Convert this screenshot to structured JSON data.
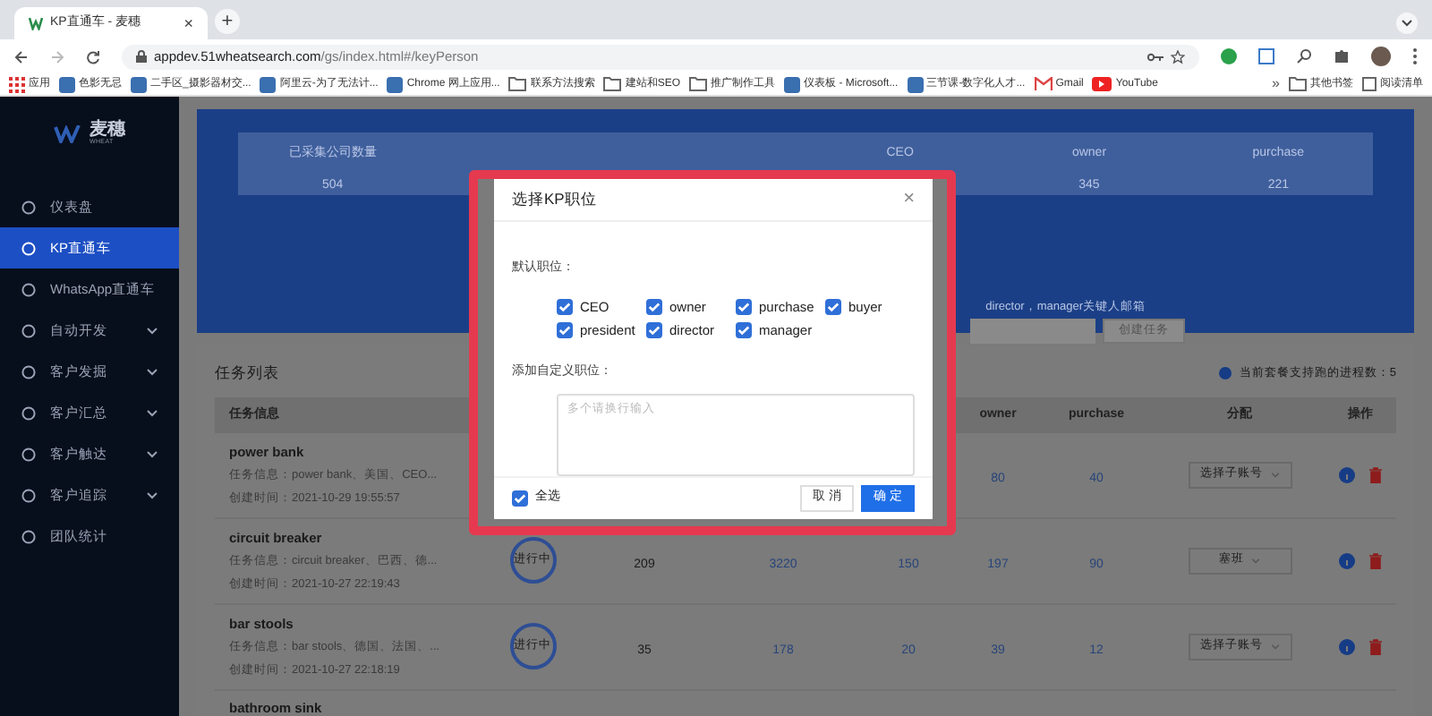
{
  "browser": {
    "tab_title": "KP直通车 - 麦穗",
    "tab_close": "×",
    "new_tab": "+",
    "url_host": "appdev.51wheatsearch.com",
    "url_path": "/gs/index.html#/keyPerson",
    "bookmarks": [
      {
        "label": "应用",
        "kind": "apps"
      },
      {
        "label": "色影无忌",
        "kind": "site"
      },
      {
        "label": "二手区_摄影器材交...",
        "kind": "site"
      },
      {
        "label": "阿里云-为了无法计...",
        "kind": "site"
      },
      {
        "label": "Chrome 网上应用...",
        "kind": "site"
      },
      {
        "label": "联系方法搜索",
        "kind": "folder"
      },
      {
        "label": "建站和SEO",
        "kind": "folder"
      },
      {
        "label": "推广制作工具",
        "kind": "folder"
      },
      {
        "label": "仪表板 - Microsoft...",
        "kind": "site"
      },
      {
        "label": "三节课-数字化人才...",
        "kind": "site"
      },
      {
        "label": "Gmail",
        "kind": "gmail"
      },
      {
        "label": "YouTube",
        "kind": "youtube"
      }
    ],
    "more": "»",
    "other_bookmarks": "其他书签",
    "reading_list": "阅读清单"
  },
  "sidebar": {
    "logo_text": "麦穗",
    "logo_sub": "WHEAT",
    "items": [
      {
        "label": "仪表盘",
        "selected": false,
        "expandable": false
      },
      {
        "label": "KP直通车",
        "selected": true,
        "expandable": false
      },
      {
        "label": "WhatsApp直通车",
        "selected": false,
        "expandable": false
      },
      {
        "label": "自动开发",
        "selected": false,
        "expandable": true
      },
      {
        "label": "客户发掘",
        "selected": false,
        "expandable": true
      },
      {
        "label": "客户汇总",
        "selected": false,
        "expandable": true
      },
      {
        "label": "客户触达",
        "selected": false,
        "expandable": true
      },
      {
        "label": "客户追踪",
        "selected": false,
        "expandable": true
      },
      {
        "label": "团队统计",
        "selected": false,
        "expandable": false
      }
    ]
  },
  "banner": {
    "stats": [
      {
        "label": "已采集公司数量",
        "value": "504"
      },
      {
        "label": "CEO"
      },
      {
        "label": "owner",
        "value": "345"
      },
      {
        "label": "purchase",
        "value": "221"
      }
    ],
    "hint": "director，manager关键人邮箱",
    "create_button": "创建任务"
  },
  "tasks": {
    "title": "任务列表",
    "quota": "当前套餐支持跑的进程数：5",
    "columns": {
      "info": "任务信息",
      "owner": "owner",
      "purchase": "purchase",
      "assign": "分配",
      "actions": "操作"
    },
    "rows": [
      {
        "name": "power bank",
        "info": "任务信息：power bank、美国、CEO...",
        "created": "创建时间：2021-10-29 19:55:57",
        "counts": [
          "80",
          "40"
        ],
        "assign": "选择子账号"
      },
      {
        "name": "circuit breaker",
        "info": "任务信息：circuit breaker、巴西、德...",
        "created": "创建时间：2021-10-27 22:19:43",
        "status": "进行中",
        "counts": [
          "209",
          "3220",
          "150",
          "197",
          "90"
        ],
        "assign": "塞班"
      },
      {
        "name": "bar stools",
        "info": "任务信息：bar stools、德国、法国、...",
        "created": "创建时间：2021-10-27 22:18:19",
        "status": "进行中",
        "counts": [
          "35",
          "178",
          "20",
          "39",
          "12"
        ],
        "assign": "选择子账号"
      },
      {
        "name": "bathroom sink"
      }
    ]
  },
  "modal": {
    "title": "选择KP职位",
    "close": "×",
    "default_label": "默认职位：",
    "options": [
      {
        "label": "CEO",
        "checked": true
      },
      {
        "label": "owner",
        "checked": true
      },
      {
        "label": "purchase",
        "checked": true
      },
      {
        "label": "buyer",
        "checked": true
      },
      {
        "label": "president",
        "checked": true
      },
      {
        "label": "director",
        "checked": true
      },
      {
        "label": "manager",
        "checked": true
      }
    ],
    "custom_label": "添加自定义职位：",
    "custom_placeholder": "多个请换行输入",
    "select_all": {
      "label": "全选",
      "checked": true
    },
    "cancel": "取 消",
    "confirm": "确 定"
  }
}
